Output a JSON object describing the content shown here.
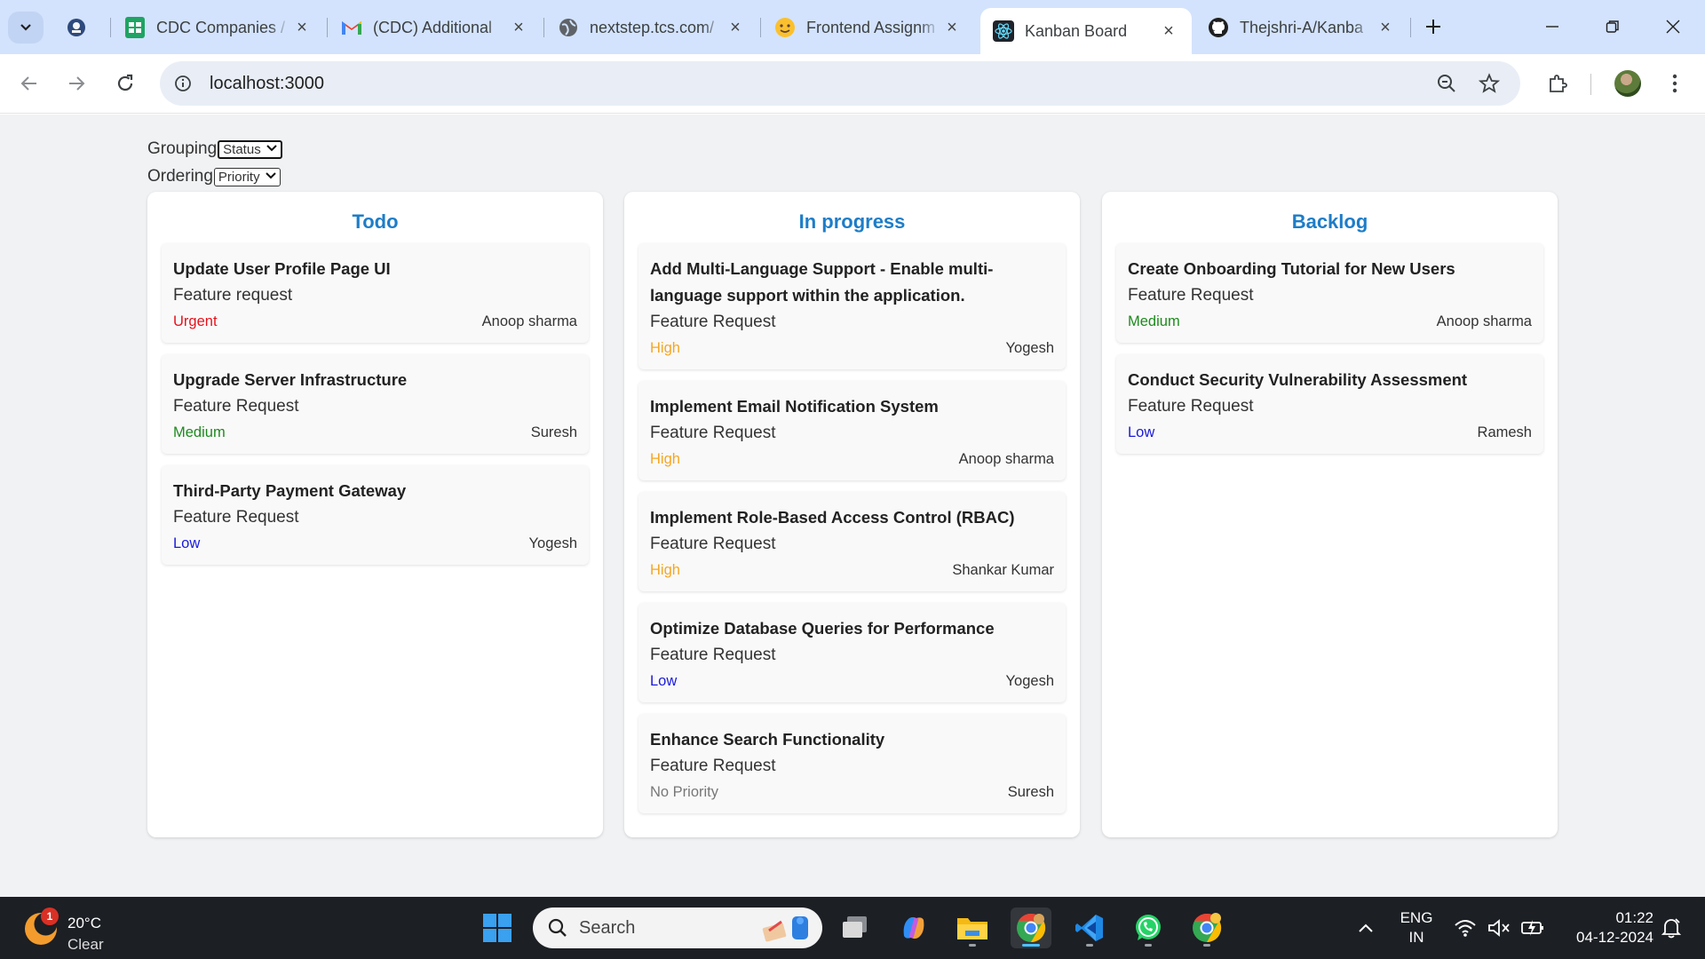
{
  "browser": {
    "tabs": [
      {
        "label": "",
        "icon": "site-logo-icon"
      },
      {
        "label": "CDC Companies /",
        "icon": "google-sheets-icon"
      },
      {
        "label": "(CDC) Additional",
        "icon": "gmail-icon"
      },
      {
        "label": "nextstep.tcs.com/",
        "icon": "globe-icon"
      },
      {
        "label": "Frontend Assignm",
        "icon": "smiley-icon"
      },
      {
        "label": "Kanban Board",
        "icon": "react-icon",
        "active": true
      },
      {
        "label": "Thejshri-A/Kanba",
        "icon": "github-icon"
      }
    ],
    "url": "localhost:3000"
  },
  "controls": {
    "grouping_label": "Grouping",
    "grouping_value": "Status",
    "ordering_label": "Ordering",
    "ordering_value": "Priority"
  },
  "colors": {
    "column_title": "#1d7dc8",
    "urgent": "#e4131c",
    "high": "#f5a623",
    "medium": "#1e8a1e",
    "low": "#1a1adb",
    "none": "#777777"
  },
  "columns": [
    {
      "title": "Todo",
      "cards": [
        {
          "title": "Update User Profile Page UI",
          "type": "Feature request",
          "priority": "Urgent",
          "level": "urgent",
          "assignee": "Anoop sharma"
        },
        {
          "title": "Upgrade Server Infrastructure",
          "type": "Feature Request",
          "priority": "Medium",
          "level": "medium",
          "assignee": "Suresh"
        },
        {
          "title": "Third-Party Payment Gateway",
          "type": "Feature Request",
          "priority": "Low",
          "level": "low",
          "assignee": "Yogesh"
        }
      ]
    },
    {
      "title": "In progress",
      "cards": [
        {
          "title": "Add Multi-Language Support - Enable multi-language support within the application.",
          "type": "Feature Request",
          "priority": "High",
          "level": "high",
          "assignee": "Yogesh"
        },
        {
          "title": "Implement Email Notification System",
          "type": "Feature Request",
          "priority": "High",
          "level": "high",
          "assignee": "Anoop sharma"
        },
        {
          "title": "Implement Role-Based Access Control (RBAC)",
          "type": "Feature Request",
          "priority": "High",
          "level": "high",
          "assignee": "Shankar Kumar"
        },
        {
          "title": "Optimize Database Queries for Performance",
          "type": "Feature Request",
          "priority": "Low",
          "level": "low",
          "assignee": "Yogesh"
        },
        {
          "title": "Enhance Search Functionality",
          "type": "Feature Request",
          "priority": "No Priority",
          "level": "none",
          "assignee": "Suresh"
        }
      ]
    },
    {
      "title": "Backlog",
      "cards": [
        {
          "title": "Create Onboarding Tutorial for New Users",
          "type": "Feature Request",
          "priority": "Medium",
          "level": "medium",
          "assignee": "Anoop sharma"
        },
        {
          "title": "Conduct Security Vulnerability Assessment",
          "type": "Feature Request",
          "priority": "Low",
          "level": "low",
          "assignee": "Ramesh"
        }
      ]
    }
  ],
  "taskbar": {
    "weather_temp": "20°C",
    "weather_cond": "Clear",
    "weather_badge": "1",
    "search_label": "Search",
    "lang_top": "ENG",
    "lang_bottom": "IN",
    "time": "01:22",
    "date": "04-12-2024"
  }
}
